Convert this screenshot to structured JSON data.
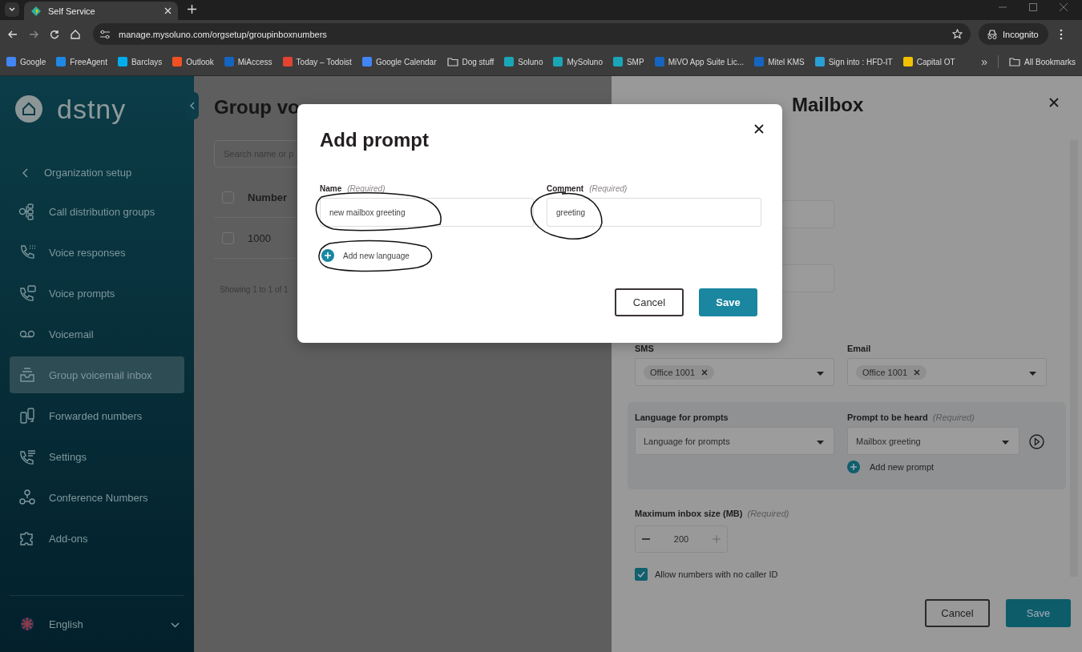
{
  "browser": {
    "tab": {
      "title": "Self Service",
      "selected": true
    },
    "url": "manage.mysoluno.com/orgsetup/groupinboxnumbers",
    "profile": "Incognito",
    "bookmarks": [
      {
        "label": "Google",
        "kind": "site",
        "color": "#4285f4"
      },
      {
        "label": "FreeAgent",
        "kind": "site",
        "color": "#1e88e5"
      },
      {
        "label": "Barclays",
        "kind": "site",
        "color": "#00aeef"
      },
      {
        "label": "Outlook",
        "kind": "site",
        "color": "#f25022"
      },
      {
        "label": "MiAccess",
        "kind": "site",
        "color": "#1565c0"
      },
      {
        "label": "Today – Todoist",
        "kind": "site",
        "color": "#e44332"
      },
      {
        "label": "Google Calendar",
        "kind": "site",
        "color": "#4285f4"
      },
      {
        "label": "Dog stuff",
        "kind": "folder"
      },
      {
        "label": "Soluno",
        "kind": "site",
        "color": "#19a7b8"
      },
      {
        "label": "MySoluno",
        "kind": "site",
        "color": "#19a7b8"
      },
      {
        "label": "SMP",
        "kind": "site",
        "color": "#19a7b8"
      },
      {
        "label": "MiVO App Suite Lic...",
        "kind": "site",
        "color": "#1565c0"
      },
      {
        "label": "Mitel KMS",
        "kind": "site",
        "color": "#1565c0"
      },
      {
        "label": "Sign into : HFD-IT",
        "kind": "site",
        "color": "#2a9fd6"
      },
      {
        "label": "Capital OT",
        "kind": "site",
        "color": "#f2c200"
      }
    ],
    "overflow": "»",
    "all_bookmarks": "All Bookmarks"
  },
  "sidebar": {
    "logo": "dstny",
    "back": "Organization setup",
    "items": [
      {
        "label": "Call distribution groups",
        "selected": false
      },
      {
        "label": "Voice responses",
        "selected": false
      },
      {
        "label": "Voice prompts",
        "selected": false
      },
      {
        "label": "Voicemail",
        "selected": false
      },
      {
        "label": "Group voicemail inbox",
        "selected": true
      },
      {
        "label": "Forwarded numbers",
        "selected": false
      },
      {
        "label": "Settings",
        "selected": false
      },
      {
        "label": "Conference Numbers",
        "selected": false
      },
      {
        "label": "Add-ons",
        "selected": false
      }
    ],
    "language": "English"
  },
  "page": {
    "title": "Group vo",
    "search": {
      "placeholder": "Search name or p"
    },
    "table": {
      "columns": [
        "Number"
      ],
      "header_checked": false,
      "rows": [
        {
          "cells": [
            "1000"
          ],
          "checked": false
        }
      ]
    },
    "footer": "Showing 1 to 1 of 1"
  },
  "edit_panel": {
    "title": "Mailbox",
    "notify": [
      {
        "label": "SMS",
        "chip": "Office 1001"
      },
      {
        "label": "Email",
        "chip": "Office 1001"
      }
    ],
    "prompt_box": {
      "language_label": "Language for prompts",
      "language_value": "Language for prompts",
      "prompt_label": "Prompt to be heard",
      "prompt_required": "(Required)",
      "prompt_value": "Mailbox greeting",
      "add_prompt": "Add new prompt"
    },
    "inbox_size": {
      "label": "Maximum inbox size (MB)",
      "required": "(Required)",
      "value": "200"
    },
    "allow_no_caller_id": {
      "label": "Allow numbers with no caller ID",
      "checked": true
    },
    "buttons": [
      "Cancel",
      "Save"
    ]
  },
  "dialog": {
    "title": "Add prompt",
    "fields": [
      {
        "label": "Name",
        "required": "(Required)",
        "value": "new mailbox greeting"
      },
      {
        "label": "Comment",
        "required": "(Required)",
        "value": "greeting"
      }
    ],
    "add_language": "Add new language",
    "buttons": [
      "Cancel",
      "Save"
    ]
  }
}
